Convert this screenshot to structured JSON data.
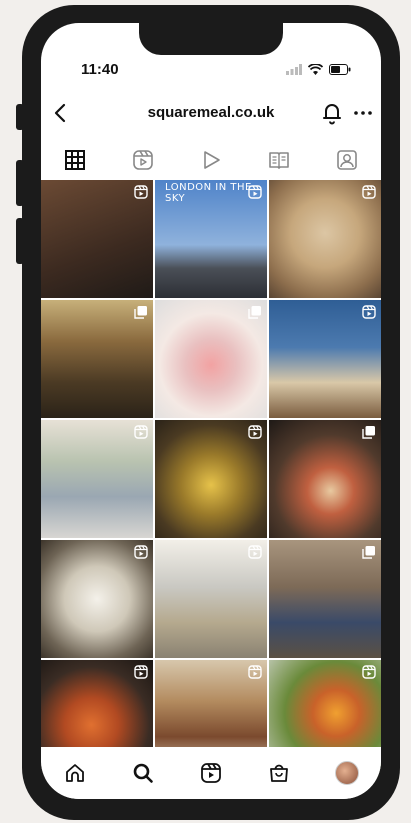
{
  "status_bar": {
    "time": "11:40"
  },
  "header": {
    "title": "squaremeal.co.uk"
  },
  "tabs": [
    "grid",
    "reels",
    "play",
    "guides",
    "tagged"
  ],
  "posts": [
    {
      "bg": "linear-gradient(160deg,#6b4a34 0%,#3c2a20 60%,#1f1a17 100%)",
      "badge": "reel"
    },
    {
      "bg": "linear-gradient(180deg,#4f83c9 0%,#8fb2dc 55%,#4a4f57 75%,#2c2f35 100%)",
      "badge": "reel",
      "caption": "LONDON IN THE SKY"
    },
    {
      "bg": "radial-gradient(circle at 50% 45%,#dcc6a4 0%,#c6a77c 40%,#8d6e4d 75%,#5a4533 100%)",
      "badge": "reel"
    },
    {
      "bg": "linear-gradient(180deg,#c7b07a 0%,#8a6a3e 35%,#4b3a24 70%,#2b2318 100%)",
      "badge": "multi"
    },
    {
      "bg": "radial-gradient(circle at 50% 55%,#f2a2a2 0%,#e9c0c0 30%,#f4e9e4 60%,#ddd 100%)",
      "badge": "multi"
    },
    {
      "bg": "linear-gradient(180deg,#2f5e95 0%,#4c7aaf 40%,#d9c8a8 70%,#7a5c3e 100%)",
      "badge": "reel"
    },
    {
      "bg": "linear-gradient(180deg,#e7e1d6 0%,#b9c3b0 35%,#9aa7b2 65%,#d8d6d2 100%)",
      "badge": "reel"
    },
    {
      "bg": "radial-gradient(circle at 50% 55%,#e6c24a 0%,#9a7a2a 35%,#4a3a22 70%,#2a2218 100%)",
      "badge": "reel"
    },
    {
      "bg": "radial-gradient(circle at 55% 60%,#e8c9a0 0%,#c06040 25%,#503a2c 60%,#1e1916 100%)",
      "badge": "multi"
    },
    {
      "bg": "radial-gradient(circle at 50% 50%,#f4f1ea 0%,#cfc8b8 40%,#6e6455 75%,#3c342a 100%)",
      "badge": "reel"
    },
    {
      "bg": "linear-gradient(180deg,#f2efe8 0%,#c9c8c2 40%,#b5a98e 70%,#8a8272 100%)",
      "badge": "reel"
    },
    {
      "bg": "linear-gradient(180deg,#a8957e 0%,#7d6a57 40%,#3a4a68 70%,#5b5144 100%)",
      "badge": "multi"
    },
    {
      "bg": "radial-gradient(circle at 45% 55%,#e07030 0%,#b24a22 30%,#3a2c24 65%,#191512 100%)",
      "badge": "reel"
    },
    {
      "bg": "linear-gradient(180deg,#d7c7ac 0%,#b38b5f 35%,#7b4a2e 65%,#e5d8c2 100%)",
      "badge": "reel"
    },
    {
      "bg": "radial-gradient(circle at 60% 45%,#f0a030 0%,#c9622a 25%,#6a8a3a 55%,#c8cfc0 100%)",
      "badge": "reel"
    }
  ],
  "bottom_nav": [
    "home",
    "search",
    "reels",
    "shop",
    "profile"
  ]
}
